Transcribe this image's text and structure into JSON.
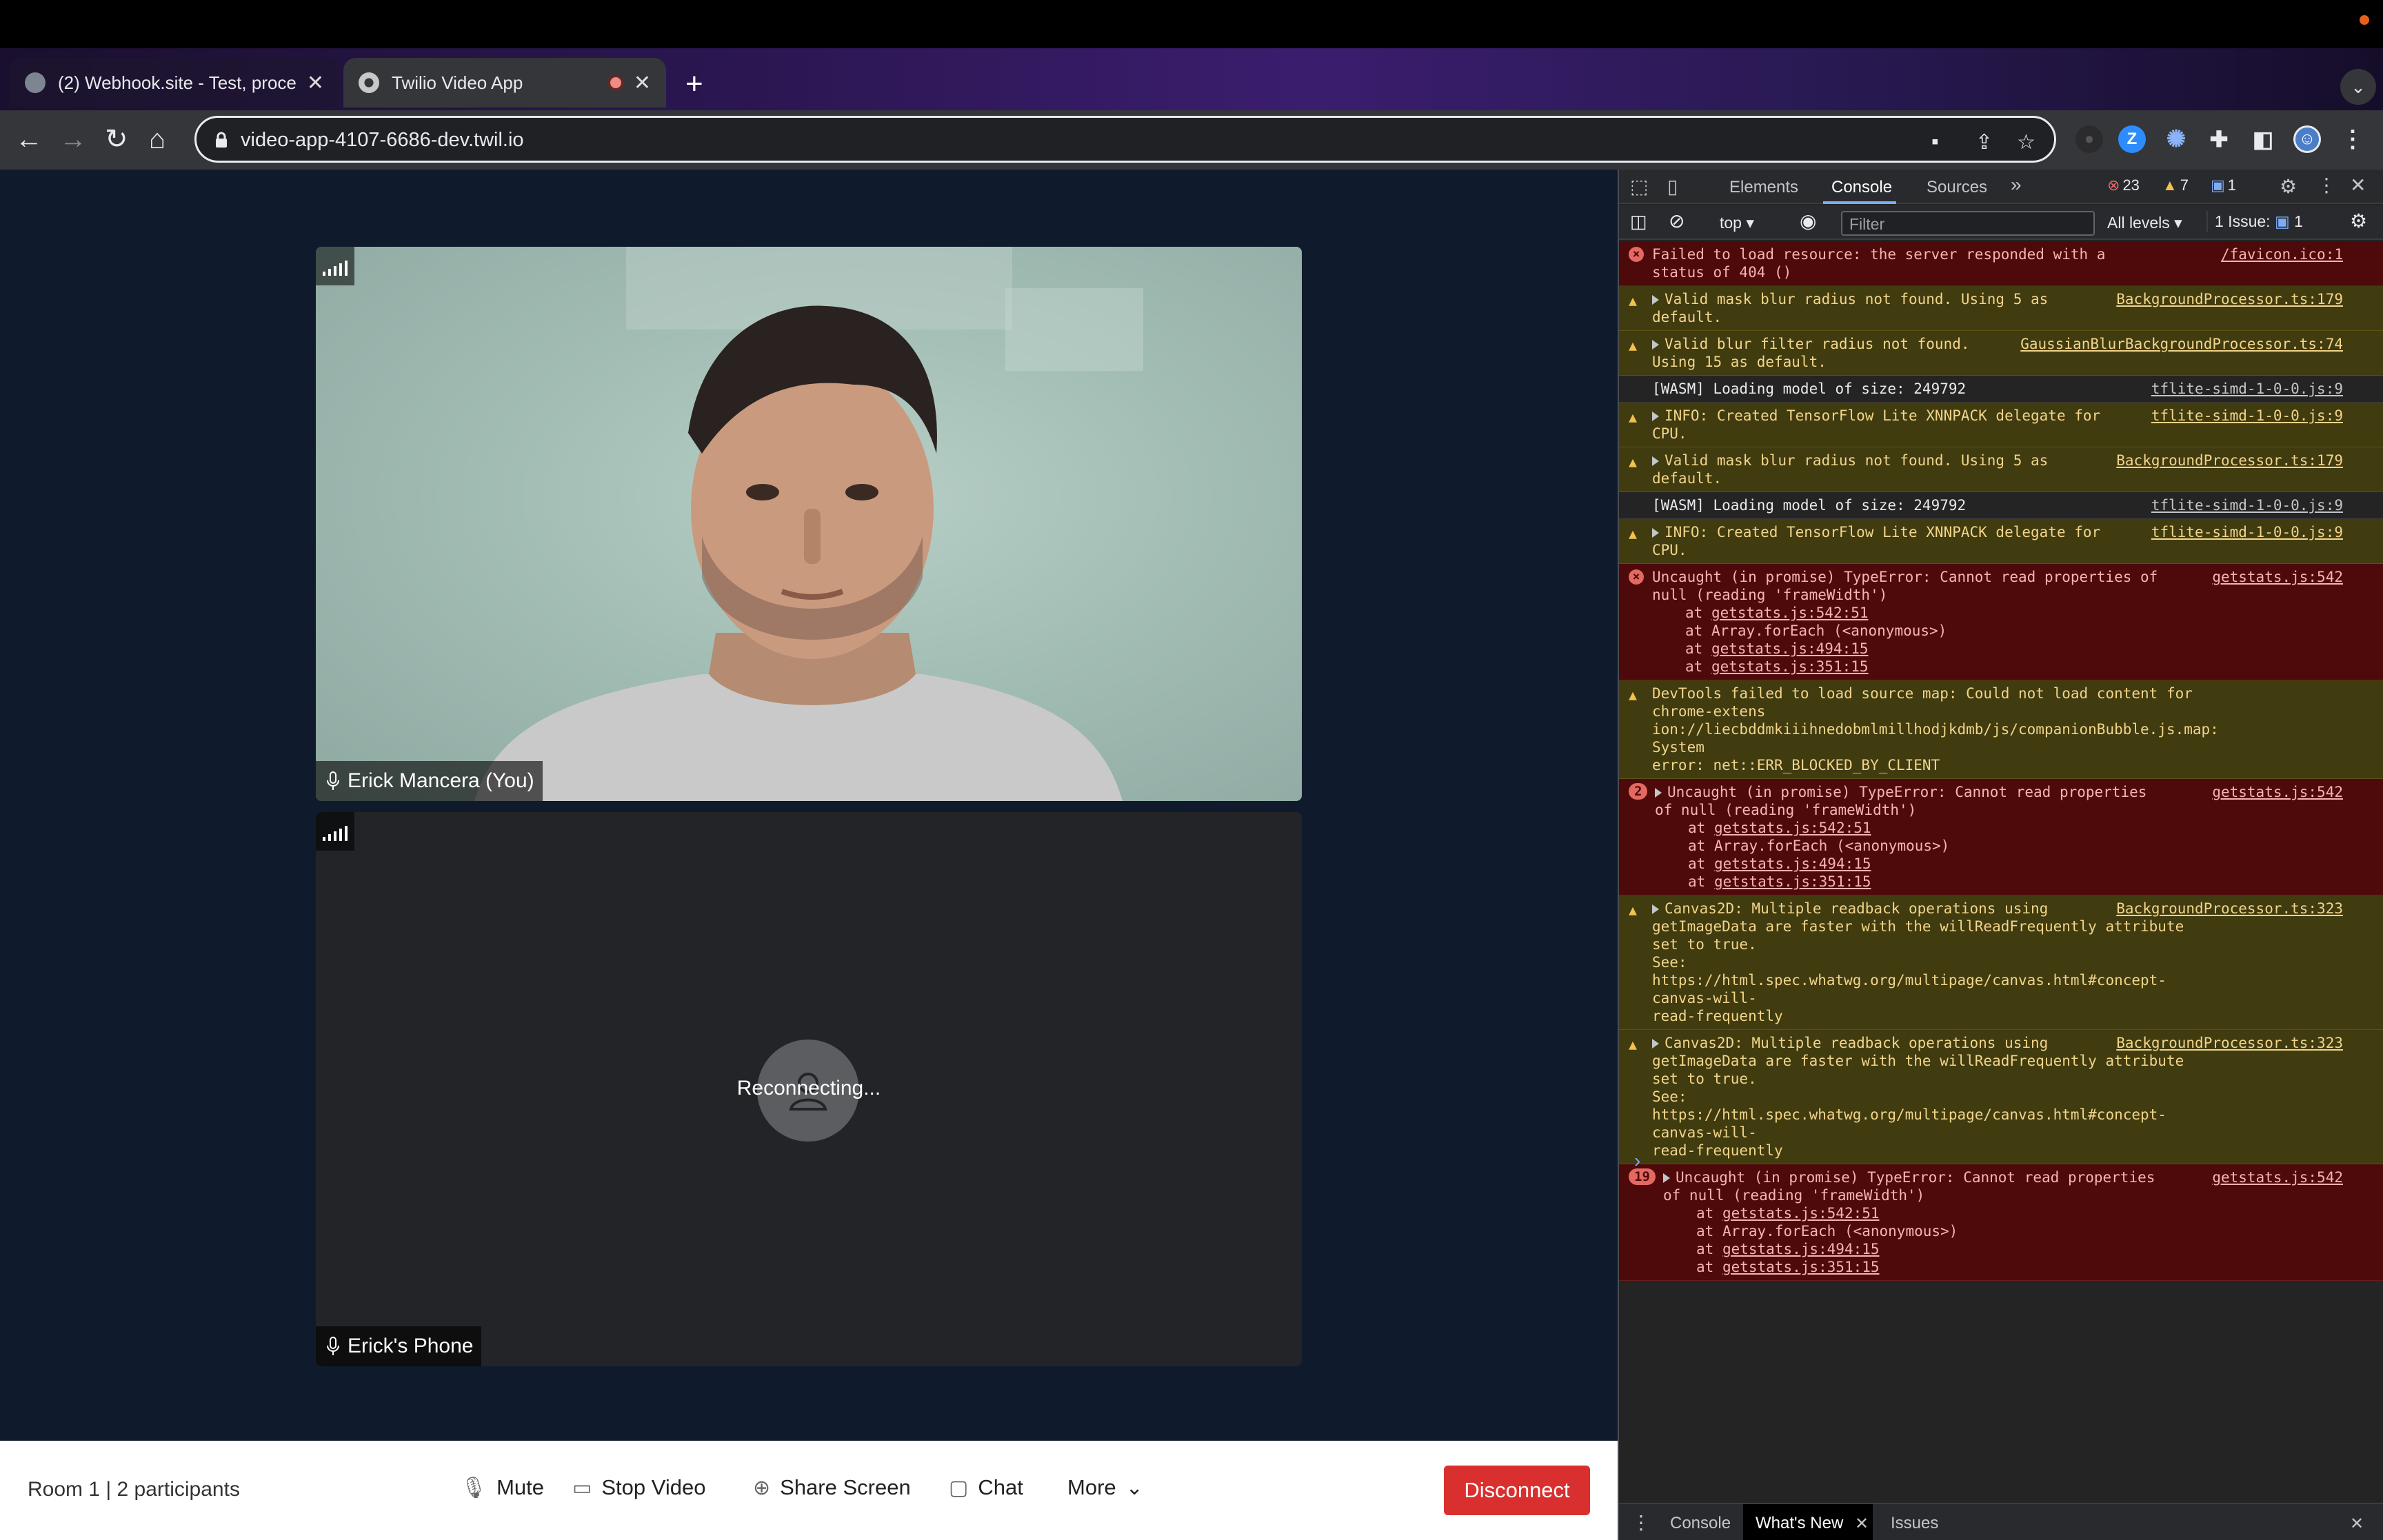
{
  "browser": {
    "tabs": [
      {
        "title": "(2) Webhook.site - Test, proce",
        "active": false
      },
      {
        "title": "Twilio Video App",
        "active": true
      }
    ],
    "url": "video-app-4107-6686-dev.twil.io",
    "accent": "#7cacf8"
  },
  "call": {
    "participants": [
      {
        "name": "Erick Mancera (You)",
        "status": ""
      },
      {
        "name": "Erick's Phone",
        "status": "Reconnecting..."
      }
    ],
    "room_info": "Room 1 | 2 participants",
    "controls": {
      "mute": "Mute",
      "stop_video": "Stop Video",
      "share_screen": "Share Screen",
      "chat": "Chat",
      "more": "More",
      "disconnect": "Disconnect"
    },
    "disconnect_color": "#d9302f"
  },
  "devtools": {
    "tabs": [
      "Elements",
      "Console",
      "Sources"
    ],
    "active_tab": "Console",
    "error_count": "23",
    "warning_count": "7",
    "info_count": "1",
    "context": "top",
    "filter_placeholder": "Filter",
    "levels": "All levels",
    "issues": "1 Issue:",
    "issues_count": "1",
    "messages": [
      {
        "level": "error",
        "count": "",
        "expandable": false,
        "text": "Failed to load resource: the server responded with a\nstatus of 404 ()",
        "source": "/favicon.ico:1",
        "stack": []
      },
      {
        "level": "warn",
        "count": "",
        "expandable": true,
        "text": "Valid mask blur radius not found. Using 5 as\ndefault.",
        "source": "BackgroundProcessor.ts:179",
        "stack": []
      },
      {
        "level": "warn",
        "count": "",
        "expandable": true,
        "text": "Valid blur filter radius not found.\nUsing 15 as default.",
        "source": "GaussianBlurBackgroundProcessor.ts:74",
        "stack": []
      },
      {
        "level": "info",
        "count": "",
        "expandable": false,
        "text": "[WASM] Loading model of size: 249792",
        "source": "tflite-simd-1-0-0.js:9",
        "stack": []
      },
      {
        "level": "warn",
        "count": "",
        "expandable": true,
        "text": "INFO: Created TensorFlow Lite XNNPACK delegate for\nCPU.",
        "source": "tflite-simd-1-0-0.js:9",
        "stack": []
      },
      {
        "level": "warn",
        "count": "",
        "expandable": true,
        "text": "Valid mask blur radius not found. Using 5 as\ndefault.",
        "source": "BackgroundProcessor.ts:179",
        "stack": []
      },
      {
        "level": "info",
        "count": "",
        "expandable": false,
        "text": "[WASM] Loading model of size: 249792",
        "source": "tflite-simd-1-0-0.js:9",
        "stack": []
      },
      {
        "level": "warn",
        "count": "",
        "expandable": true,
        "text": "INFO: Created TensorFlow Lite XNNPACK delegate for\nCPU.",
        "source": "tflite-simd-1-0-0.js:9",
        "stack": []
      },
      {
        "level": "error",
        "count": "",
        "expandable": false,
        "text": "Uncaught (in promise) TypeError: Cannot read properties of\nnull (reading 'frameWidth')",
        "source": "getstats.js:542",
        "stack": [
          "getstats.js:542:51",
          "Array.forEach (<anonymous>)",
          "getstats.js:494:15",
          "getstats.js:351:15"
        ]
      },
      {
        "level": "warn",
        "count": "",
        "expandable": false,
        "text": "DevTools failed to load source map: Could not load content for chrome-extens\nion://liecbddmkiiihnedobmlmillhodjkdmb/js/companionBubble.js.map: System\nerror: net::ERR_BLOCKED_BY_CLIENT",
        "source": "",
        "stack": []
      },
      {
        "level": "error",
        "count": "2",
        "expandable": true,
        "text": "Uncaught (in promise) TypeError: Cannot read properties\nof null (reading 'frameWidth')",
        "source": "getstats.js:542",
        "stack": [
          "getstats.js:542:51",
          "Array.forEach (<anonymous>)",
          "getstats.js:494:15",
          "getstats.js:351:15"
        ]
      },
      {
        "level": "warn",
        "count": "",
        "expandable": true,
        "text": "Canvas2D: Multiple readback operations using\ngetImageData are faster with the willReadFrequently attribute set to true.\nSee: https://html.spec.whatwg.org/multipage/canvas.html#concept-canvas-will-\nread-frequently",
        "source": "BackgroundProcessor.ts:323",
        "stack": []
      },
      {
        "level": "warn",
        "count": "",
        "expandable": true,
        "text": "Canvas2D: Multiple readback operations using\ngetImageData are faster with the willReadFrequently attribute set to true.\nSee: https://html.spec.whatwg.org/multipage/canvas.html#concept-canvas-will-\nread-frequently",
        "source": "BackgroundProcessor.ts:323",
        "stack": []
      },
      {
        "level": "error",
        "count": "19",
        "expandable": true,
        "text": "Uncaught (in promise) TypeError: Cannot read properties\nof null (reading 'frameWidth')",
        "source": "getstats.js:542",
        "stack": [
          "getstats.js:542:51",
          "Array.forEach (<anonymous>)",
          "getstats.js:494:15",
          "getstats.js:351:15"
        ]
      }
    ],
    "drawer_tabs": [
      "Console",
      "What's New",
      "Issues"
    ],
    "drawer_active": "What's New"
  }
}
